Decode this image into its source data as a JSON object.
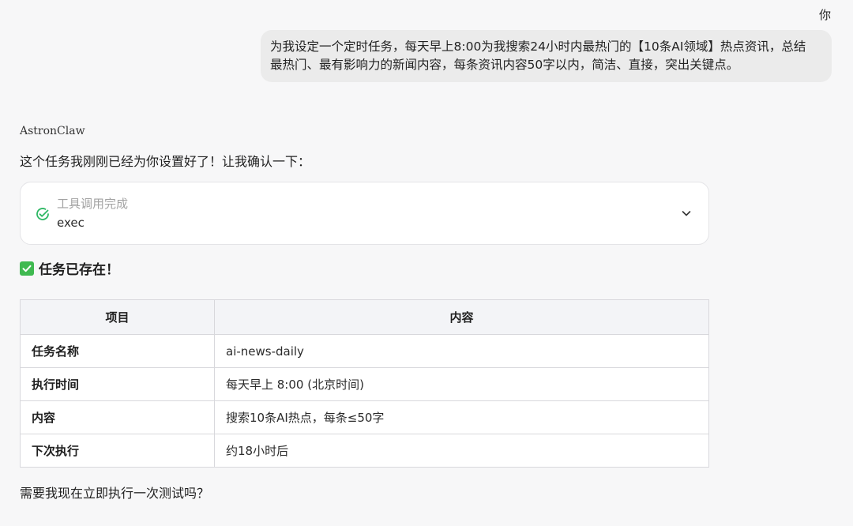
{
  "user": {
    "label": "你",
    "message": "为我设定一个定时任务，每天早上8:00为我搜索24小时内最热门的【10条AI领域】热点资讯，总结最热门、最有影响力的新闻内容，每条资讯内容50字以内，简洁、直接，突出关键点。"
  },
  "assistant": {
    "name": "AstronClaw",
    "intro": "这个任务我刚刚已经为你设置好了！让我确认一下：",
    "tool_call": {
      "status": "工具调用完成",
      "name": "exec",
      "check_icon": "check-circle-icon",
      "expand_icon": "chevron-down-icon"
    },
    "exists_text": "任务已存在！",
    "exists_icon": "check-mark-button-icon",
    "table": {
      "headers": [
        "项目",
        "内容"
      ],
      "rows": [
        [
          "任务名称",
          "ai-news-daily"
        ],
        [
          "执行时间",
          "每天早上 8:00 (北京时间)"
        ],
        [
          "内容",
          "搜索10条AI热点，每条≤50字"
        ],
        [
          "下次执行",
          "约18小时后"
        ]
      ]
    },
    "followup": "需要我现在立即执行一次测试吗？"
  },
  "colors": {
    "accent_green": "#2fb865",
    "check_box_green": "#3fb950",
    "bubble_bg": "#ebebeb",
    "page_bg": "#f7f7f8"
  }
}
